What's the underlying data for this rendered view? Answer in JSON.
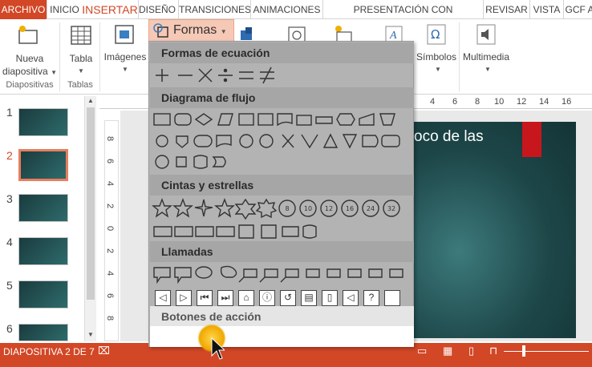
{
  "tabs": [
    {
      "label": "ARCHIVO"
    },
    {
      "label": "INICIO"
    },
    {
      "label": "INSERTAR"
    },
    {
      "label": "DISEÑO"
    },
    {
      "label": "TRANSICIONES"
    },
    {
      "label": "ANIMACIONES"
    },
    {
      "label": "PRESENTACIÓN CON DIAPOSITIVAS"
    },
    {
      "label": "REVISAR"
    },
    {
      "label": "VISTA"
    },
    {
      "label": "GCF A"
    }
  ],
  "ribbon": {
    "nueva_1": "Nueva",
    "nueva_2": "diapositiva",
    "tabla": "Tabla",
    "imagenes": "Imágenes",
    "formas": "Formas",
    "simbolos": "Símbolos",
    "multimedia": "Multimedia",
    "group_diapositivas": "Diapositivas",
    "group_tablas": "Tablas"
  },
  "dropdown": {
    "sections": [
      {
        "title": "Formas de ecuación"
      },
      {
        "title": "Diagrama de flujo"
      },
      {
        "title": "Cintas y estrellas"
      },
      {
        "title": "Llamadas"
      },
      {
        "title": "Botones de acción"
      }
    ],
    "action_help": "?"
  },
  "ruler": {
    "h": [
      "4",
      "6",
      "8",
      "10",
      "12",
      "14",
      "16"
    ],
    "v": [
      "8",
      "6",
      "4",
      "2",
      "0",
      "2",
      "4",
      "6",
      "8"
    ]
  },
  "thumbnails": [
    {
      "num": "1"
    },
    {
      "num": "2"
    },
    {
      "num": "3"
    },
    {
      "num": "4"
    },
    {
      "num": "5"
    },
    {
      "num": "6"
    }
  ],
  "slide": {
    "title_fragment": "oco de las"
  },
  "status": {
    "text": "DIAPOSITIVA 2 DE 7"
  },
  "colors": {
    "accent": "#d24726",
    "slide_bg": "#1d4648",
    "red_bar": "#c8161d"
  },
  "icons": {
    "formas": "shapes-icon",
    "cursor": "mouse-pointer-icon"
  }
}
